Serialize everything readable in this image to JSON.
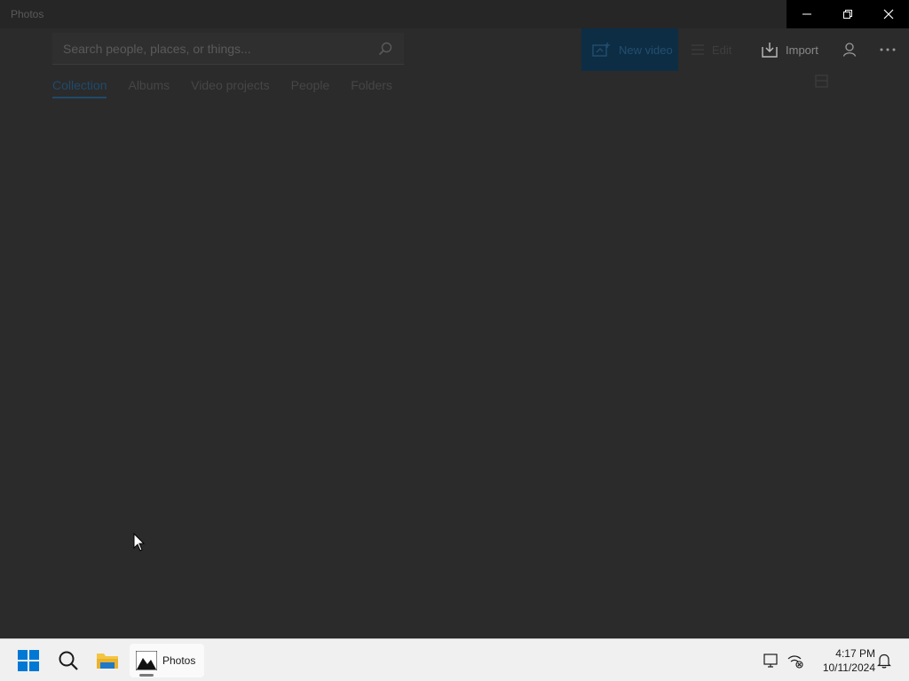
{
  "window": {
    "title": "Photos",
    "controls": {
      "minimize": "minimize-icon",
      "restore": "restore-icon",
      "close": "close-icon"
    }
  },
  "search": {
    "placeholder": "Search people, places, or things...",
    "value": ""
  },
  "toolbar": {
    "new_video_label": "New video",
    "edit_label": "Edit",
    "import_label": "Import"
  },
  "tabs": [
    {
      "label": "Collection",
      "active": true
    },
    {
      "label": "Albums",
      "active": false
    },
    {
      "label": "Video projects",
      "active": false
    },
    {
      "label": "People",
      "active": false
    },
    {
      "label": "Folders",
      "active": false
    }
  ],
  "taskbar": {
    "active_app_label": "Photos",
    "time": "4:17 PM",
    "date": "10/11/2024"
  },
  "colors": {
    "app_background": "#2b2b2b",
    "accent": "#0d2d44",
    "taskbar_background": "#f0f0f0",
    "windows_logo": "#0078d4"
  }
}
